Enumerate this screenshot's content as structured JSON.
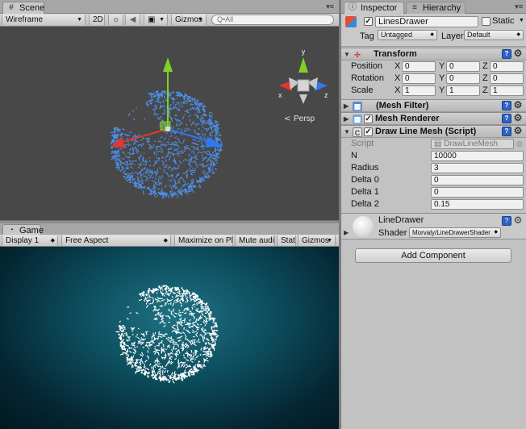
{
  "scene": {
    "tab_label": "Scene",
    "tab_icon": "scene-grid-icon",
    "toolbar": {
      "draw_mode": "Wireframe",
      "mode_2d": "2D",
      "lighting_icon": "sun-icon",
      "audio_icon": "speaker-icon",
      "effects_icon": "image-icon",
      "gizmos_label": "Gizmos",
      "search_placeholder": "Q•All"
    },
    "persp_label": "Persp",
    "gizmo_axes": {
      "y": "y",
      "x": "x",
      "z": "z"
    }
  },
  "game": {
    "tab_label": "Game",
    "tab_icon": "pacman-icon",
    "toolbar": {
      "display": "Display 1",
      "aspect": "Free Aspect",
      "maximize_on_play": "Maximize on Play",
      "mute_audio": "Mute audio",
      "stats": "Stats",
      "gizmos": "Gizmos"
    }
  },
  "inspector": {
    "tab_label": "Inspector",
    "hierarchy_tab_label": "Hierarchy",
    "object_name": "LinesDrawer",
    "object_active": true,
    "static_label": "Static",
    "static_checked": false,
    "tag_label": "Tag",
    "tag_value": "Untagged",
    "layer_label": "Layer",
    "layer_value": "Default",
    "transform": {
      "title": "Transform",
      "position_label": "Position",
      "rotation_label": "Rotation",
      "scale_label": "Scale",
      "axis_x": "X",
      "axis_y": "Y",
      "axis_z": "Z",
      "position": [
        "0",
        "0",
        "0"
      ],
      "rotation": [
        "0",
        "0",
        "0"
      ],
      "scale": [
        "1",
        "1",
        "1"
      ]
    },
    "mesh_filter": {
      "title": "(Mesh Filter)"
    },
    "mesh_renderer": {
      "title": "Mesh Renderer",
      "enabled": true
    },
    "draw_line_mesh": {
      "title": "Draw Line Mesh (Script)",
      "enabled": true,
      "script_label": "Script",
      "script_value": "DrawLineMesh",
      "fields": [
        {
          "label": "N",
          "value": "10000"
        },
        {
          "label": "Radius",
          "value": "3"
        },
        {
          "label": "Delta 0",
          "value": "0"
        },
        {
          "label": "Delta 1",
          "value": "0"
        },
        {
          "label": "Delta 2",
          "value": "0.15"
        }
      ]
    },
    "material": {
      "name": "LineDrawer",
      "shader_label": "Shader",
      "shader_value": "Morvaly/LineDrawerShader"
    },
    "add_component_label": "Add Component"
  },
  "colors": {
    "accent_blue": "#2d63c9",
    "gizmo_x": "#e0382b",
    "gizmo_y": "#7fd12a",
    "gizmo_z": "#2f78f0",
    "mesh_scene": "#4d8fe8",
    "mesh_game": "#ffffff"
  }
}
